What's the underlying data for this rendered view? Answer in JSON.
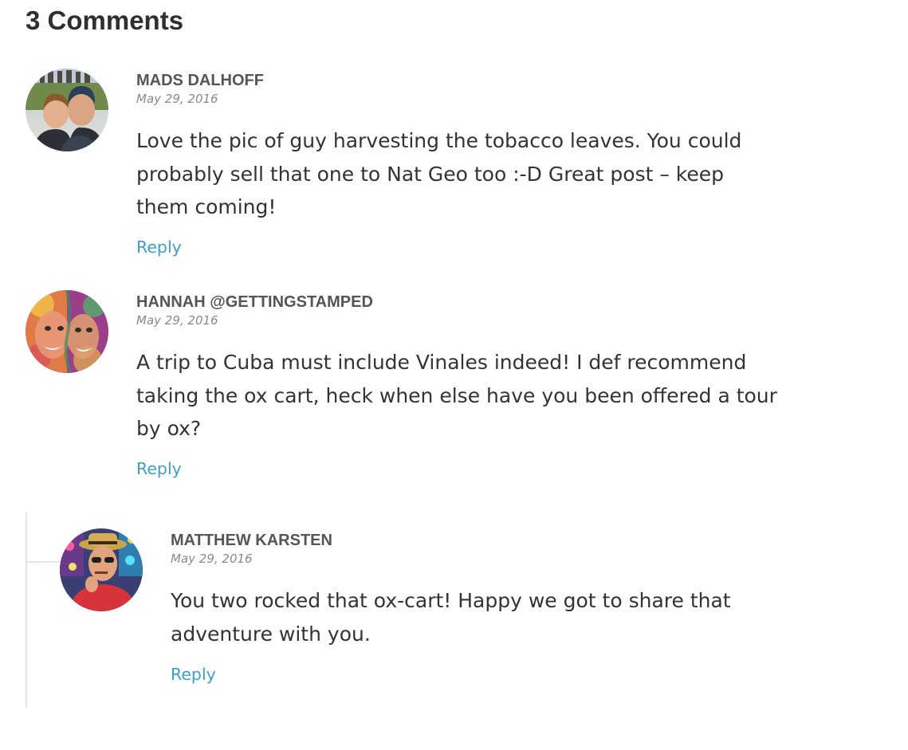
{
  "comments_heading": "3 Comments",
  "comments": [
    {
      "author": "Mads Dalhoff",
      "date": "May 29, 2016",
      "text_lines": [
        "Love the pic of guy harvesting the tobacco leaves. You could",
        "probably sell that one to Nat Geo too :-D Great post – keep",
        "them coming!"
      ],
      "reply_label": "Reply",
      "avatar_icon": "couple-photo-avatar"
    },
    {
      "author": "Hannah @GettingStamped",
      "date": "May 29, 2016",
      "text_lines": [
        "A trip to Cuba must include Vinales indeed! I def recommend",
        "taking the ox cart, heck when else have you been offered a tour",
        "by ox?"
      ],
      "reply_label": "Reply",
      "avatar_icon": "painted-faces-avatar"
    },
    {
      "author": "Matthew Karsten",
      "date": "May 29, 2016",
      "text_lines": [
        "You two rocked that ox-cart! Happy we got to share that",
        "adventure with you."
      ],
      "reply_label": "Reply",
      "avatar_icon": "man-with-hat-avatar",
      "is_reply": true
    }
  ],
  "colors": {
    "link": "#3d9fc4",
    "author": "#555555",
    "date": "#8a8a8a",
    "text": "#333333",
    "thread_line": "#e4e4e4"
  }
}
